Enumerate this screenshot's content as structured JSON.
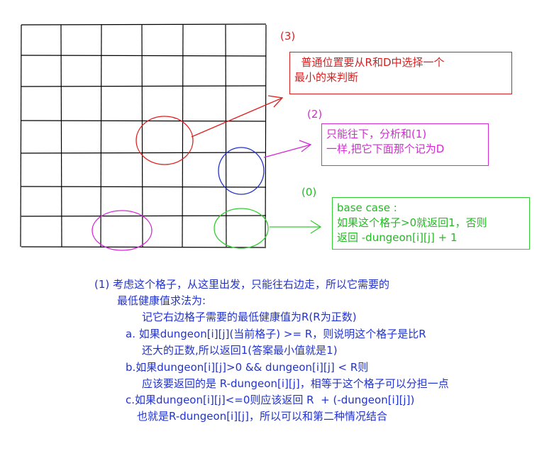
{
  "labels": {
    "tag3": "(3)",
    "tag2": "(2)",
    "tag0": "(0)"
  },
  "box3": {
    "line1": "  普通位置要从R和D中选择一个",
    "line2": "最小的来判断"
  },
  "box2": {
    "line1": "只能往下，分析和(1)",
    "line2": "一样,把它下面那个记为D"
  },
  "box0": {
    "line1": "base case :",
    "line2": "如果这个格子>0就返回1，否则",
    "line3": "返回 -dungeon[i][j] + 1"
  },
  "explanation": {
    "l1": "(1) 考虑这个格子，从这里出发，只能往右边走，所以它需要的",
    "l2": "最低健康值求法为:",
    "l3": "记它右边格子需要的最低健康值为R(R为正数)",
    "l4": "a. 如果dungeon[i][j](当前格子) >= R，则说明这个格子是比R",
    "l5": "还大的正数,所以返回1(答案最小值就是1)",
    "l6": "b.如果dungeon[i][j]>0 && dungeon[i][j] < R则",
    "l7": "应该要返回的是 R-dungeon[i][j]，相等于这个格子可以分担一点",
    "l8": "c.如果dungeon[i][j]<=0则应该返回 R  + (-dungeon[i][j])",
    "l9": "也就是R-dungeon[i][j]，所以可以和第二种情况结合"
  },
  "colors": {
    "red": "#d42020",
    "magenta": "#d42ad4",
    "green": "#33cc33",
    "blue": "#2233cc",
    "grid": "#000000"
  }
}
